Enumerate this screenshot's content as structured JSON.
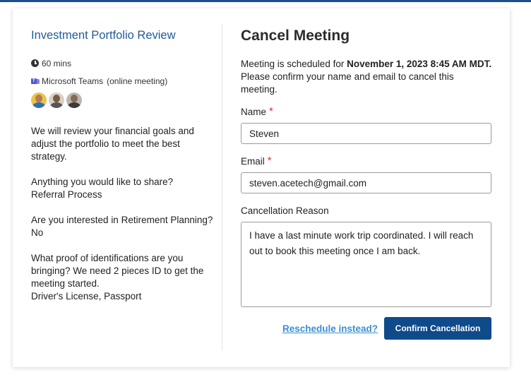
{
  "event": {
    "title": "Investment Portfolio Review",
    "duration": "60 mins",
    "location": "Microsoft Teams",
    "location_note": "(online meeting)",
    "description": "We will review your financial goals and adjust the portfolio to meet the best strategy.",
    "answers": [
      {
        "question": "Anything you would like to share?",
        "answer": "Referral Process"
      },
      {
        "question": "Are you interested in Retirement Planning?",
        "answer": "No"
      },
      {
        "question": "What proof of identifications are you bringing? We need 2 pieces ID to get the meeting started.",
        "answer": "Driver's License, Passport"
      }
    ]
  },
  "form": {
    "heading": "Cancel Meeting",
    "sched_prefix": "Meeting is scheduled for ",
    "sched_date": "November 1, 2023 8:45 AM MDT.",
    "sched_suffix": "Please confirm your name and email to cancel this meeting.",
    "name_label": "Name",
    "name_value": "Steven",
    "email_label": "Email",
    "email_value": "steven.acetech@gmail.com",
    "reason_label": "Cancellation Reason",
    "reason_value": "I have a last minute work trip coordinated. I will reach out to book this meeting once I am back.",
    "required_mark": "*",
    "reschedule_label": "Reschedule instead?",
    "confirm_label": "Confirm Cancellation"
  },
  "icons": {
    "duration": "clock-icon",
    "location": "microsoft-teams-icon"
  },
  "colors": {
    "title": "#1f5a9c",
    "primary_button": "#0f4a8a",
    "link": "#3a8fd3",
    "required": "#d9342b"
  }
}
